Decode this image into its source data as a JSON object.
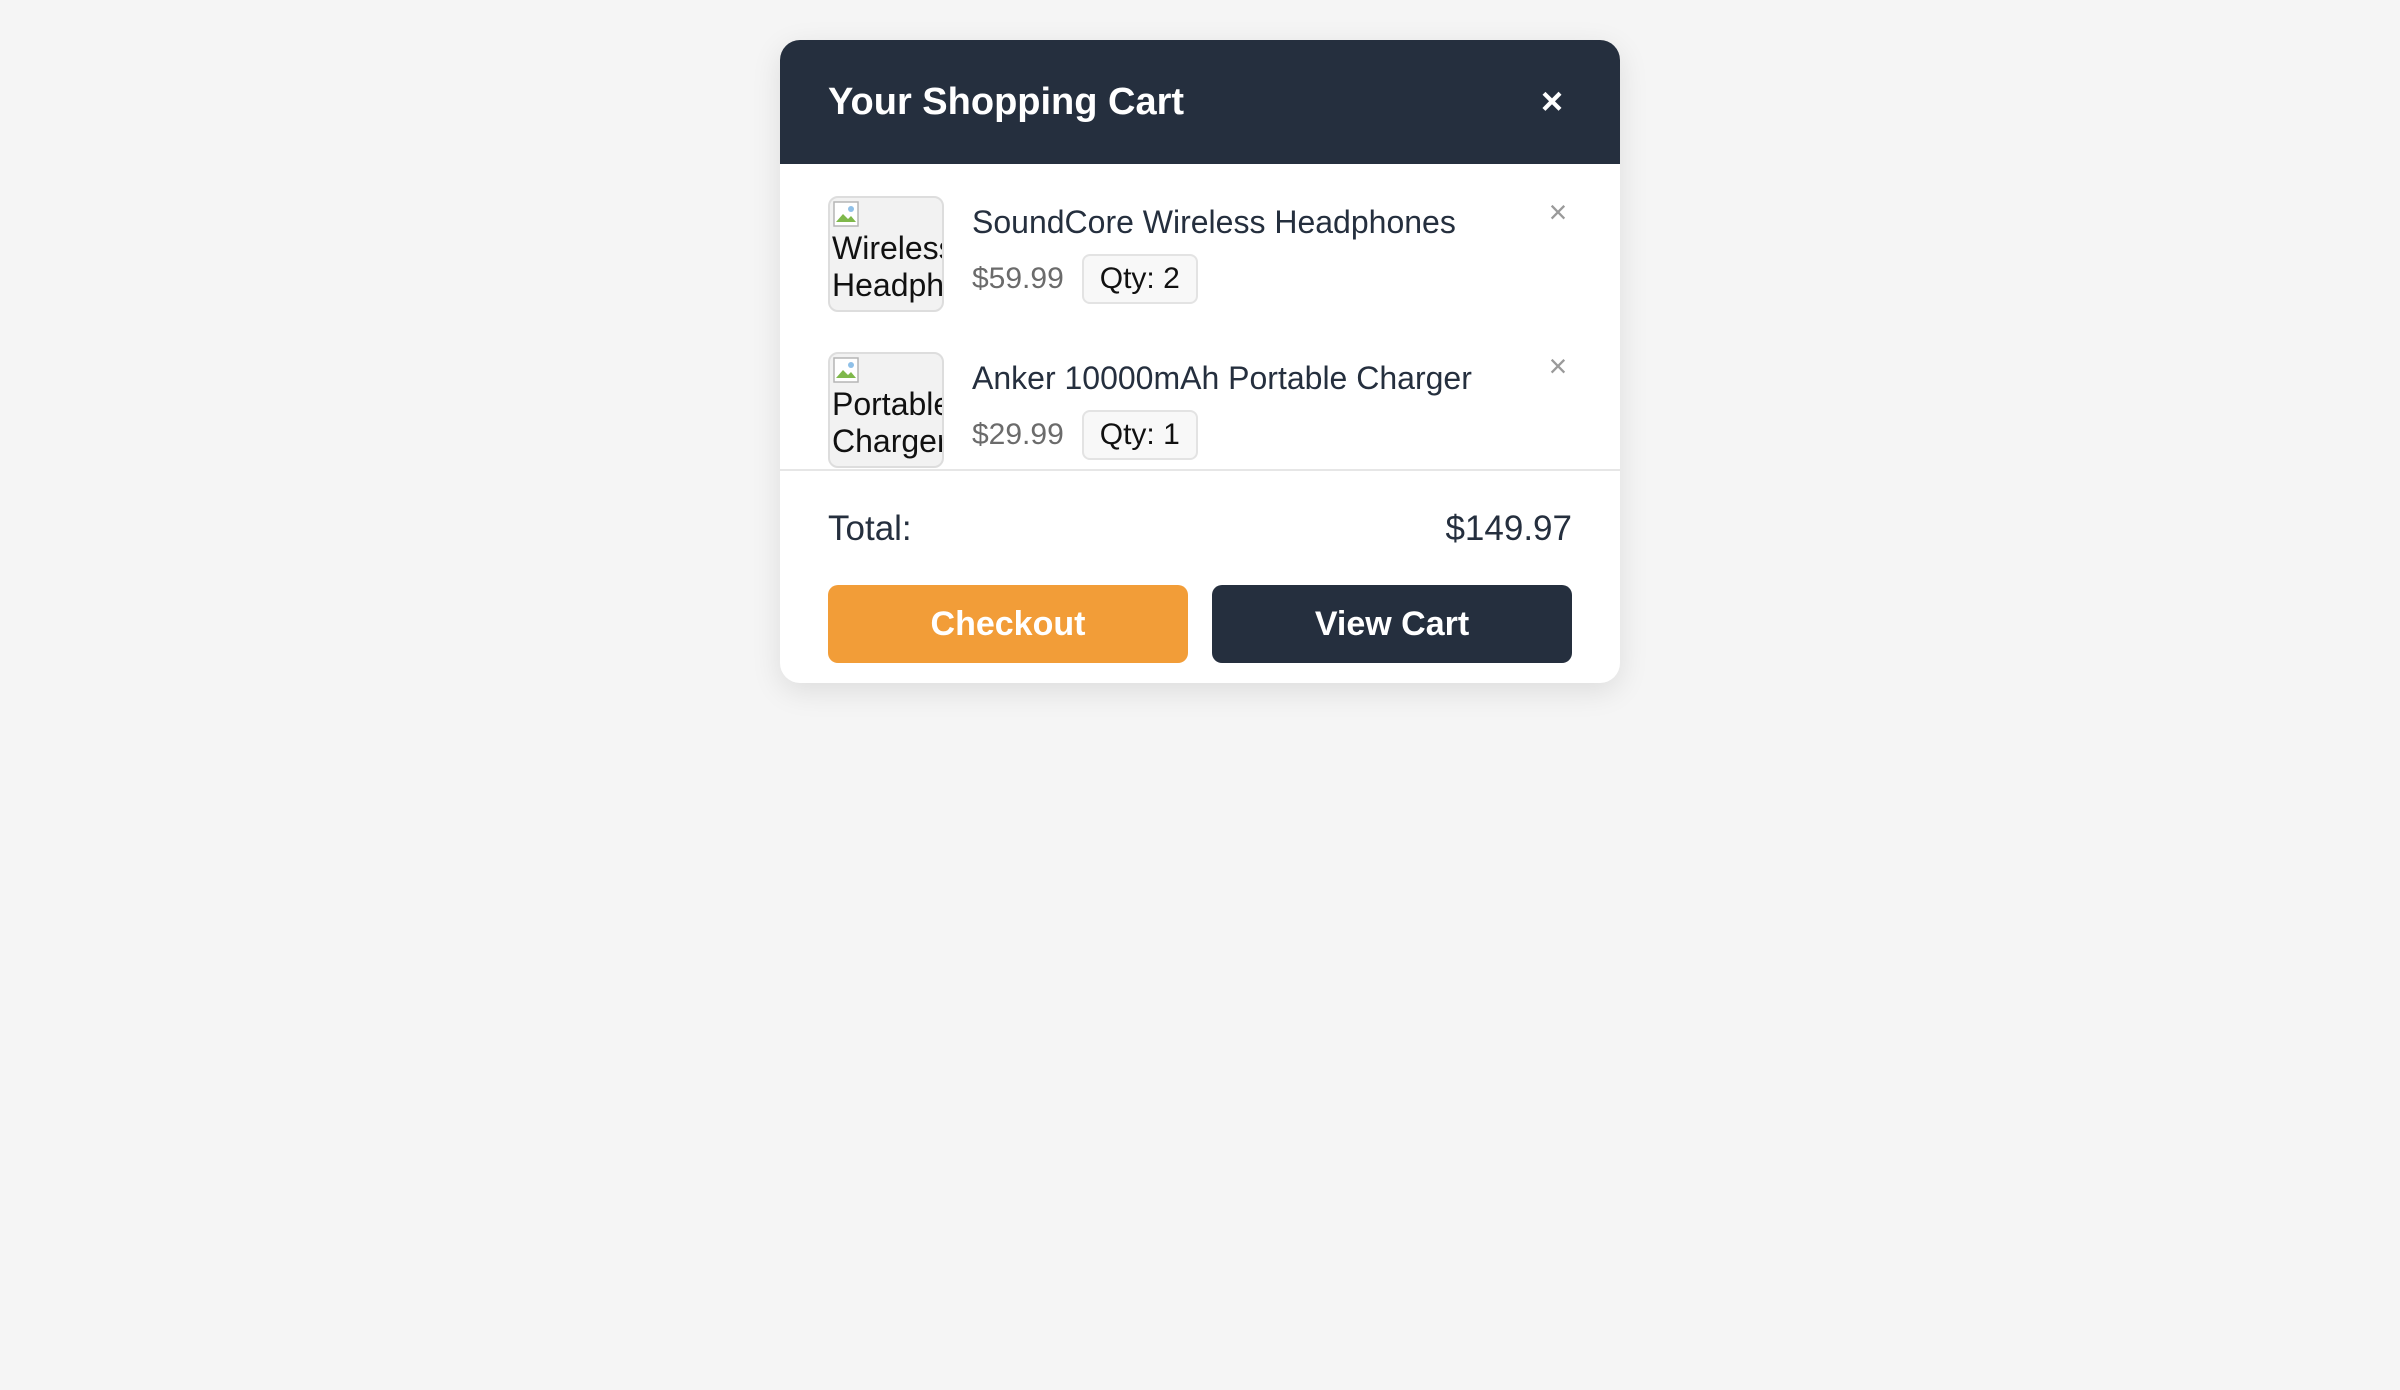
{
  "cart": {
    "title": "Your Shopping Cart",
    "close_symbol": "×",
    "items": [
      {
        "name": "SoundCore Wireless Headphones",
        "price": "$59.99",
        "qty": "Qty: 2",
        "image_alt_line1": "Wireless",
        "image_alt_line2": "Headph",
        "remove_symbol": "×"
      },
      {
        "name": "Anker 10000mAh Portable Charger",
        "price": "$29.99",
        "qty": "Qty: 1",
        "image_alt_line1": "Portable",
        "image_alt_line2": "Charger",
        "remove_symbol": "×"
      }
    ],
    "total_label": "Total:",
    "total_value": "$149.97",
    "checkout_label": "Checkout",
    "view_cart_label": "View Cart"
  },
  "colors": {
    "header_bg": "#252f3e",
    "checkout_bg": "#f29d38",
    "view_cart_bg": "#252f3e",
    "page_bg": "#f5f5f5"
  },
  "icons": {
    "close": "close-icon",
    "remove": "remove-item-icon",
    "broken_image": "broken-image-icon"
  }
}
